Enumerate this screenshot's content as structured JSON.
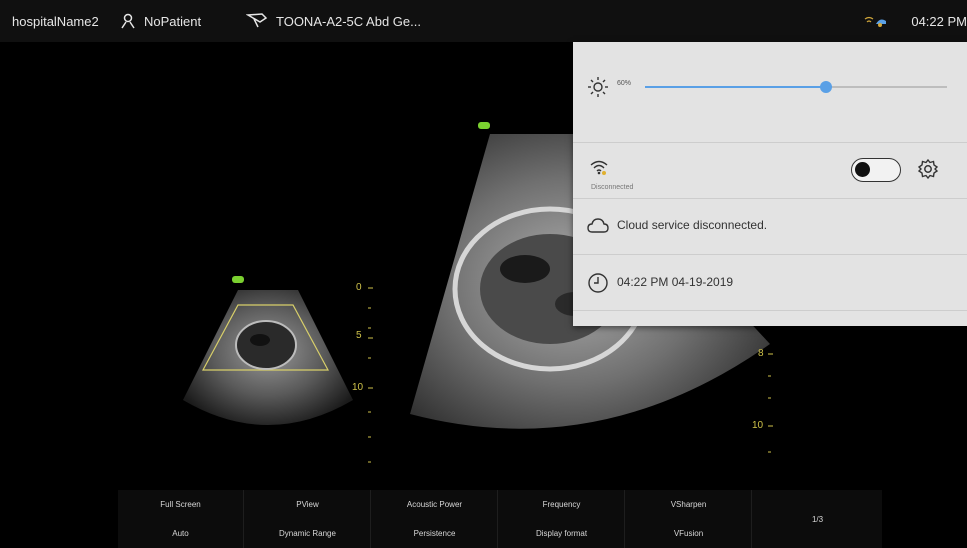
{
  "topbar": {
    "hospital_name": "hospitalName2",
    "patient": "NoPatient",
    "probe": "TOONA-A2-5C Abd Ge...",
    "time": "04:22 PM"
  },
  "icons": {
    "patient": "person-icon",
    "probe": "probe-icon",
    "network": "network-status-icon",
    "brightness": "sun-icon",
    "wifi": "wifi-icon",
    "settings": "gear-icon",
    "cloud": "cloud-icon",
    "clock": "clock-icon"
  },
  "panel": {
    "brightness_percent_label": "60%",
    "brightness_value": 0.6,
    "wifi_status": "Disconnected",
    "wifi_enabled": false,
    "cloud_status": "Cloud service disconnected.",
    "datetime": "04:22 PM 04-19-2019"
  },
  "scales": {
    "left": [
      "0",
      "5",
      "10"
    ],
    "right": [
      "8",
      "10"
    ]
  },
  "toolbar": {
    "buttons_top": [
      "Full Screen",
      "PView",
      "Acoustic Power",
      "Frequency",
      "VSharpen"
    ],
    "buttons_bottom": [
      "Auto",
      "Dynamic Range",
      "Persistence",
      "Display format",
      "VFusion"
    ],
    "page": "1/3"
  },
  "colors": {
    "accent": "#5aa0e6",
    "scale": "#cfc24a",
    "probe_mark": "#7bd030",
    "panel_bg": "#e3e3e3"
  }
}
